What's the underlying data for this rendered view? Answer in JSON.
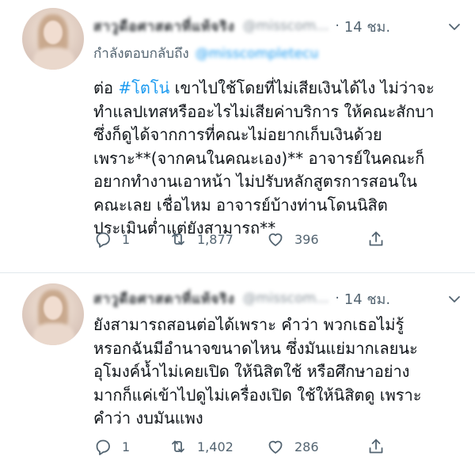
{
  "tweets": [
    {
      "author_name": "สาวูดือศาสดาที่แท้จริง",
      "author_handle": "@misscom...",
      "separator": "·",
      "time": "14 ชม.",
      "reply_label": "กำลังตอบกลับถึง",
      "reply_handle": "@misscompletecu",
      "text_lines": [
        "ต่อ",
        "#โตโน่",
        "เขาไปใช้โดยที่ไม่เสียเงินได้ไง ไม่ว่าจะ",
        "ทำแลปเทสหรืออะไรไม่เสียค่าบริการ ให้คณะสักบา",
        "ซึ่งก็ดูได้จากการที่คณะไม่อยากเก็บเงินด้วย",
        "เพราะ**(จากคนในคณะเอง)** อาจารย์ในคณะก็",
        "อยากทำงานเอาหน้า ไม่ปรับหลักสูตรการสอนใน",
        "คณะเลย เชื่อไหม อาจารย์บ้างท่านโดนนิสิต",
        "ประเมินต่ำแต่ยังสามารถ**"
      ],
      "replies": "1",
      "retweets": "1,877",
      "likes": "396"
    },
    {
      "author_name": "สาวูดือศาสดาที่แท้จริง",
      "author_handle": "@misscom...",
      "separator": "·",
      "time": "14 ชม.",
      "text_lines": [
        "ยังสามารถสอนต่อได้เพราะ คำว่า พวกเธอไม่รู้",
        "หรอกฉันมีอำนาจขนาดไหน ซึ่งมันแย่มากเลยนะ",
        "อุโมงค์น้ำไม่เคยเปิด ให้นิสิตใช้ หรือศึกษาอย่าง",
        "มากก็แค่เข้าไปดูไม่เครื่องเปิด ใช้ให้นิสิตดู เพราะ",
        "คำว่า งบมันแพง"
      ],
      "replies": "1",
      "retweets": "1,402",
      "likes": "286"
    }
  ],
  "icons": {
    "more": "chevron-down-icon",
    "reply": "reply-icon",
    "retweet": "retweet-icon",
    "like": "heart-icon",
    "share": "share-icon"
  },
  "colors": {
    "accent": "#1d9bf0",
    "secondary_text": "#536471",
    "divider": "#e1e8ed"
  }
}
